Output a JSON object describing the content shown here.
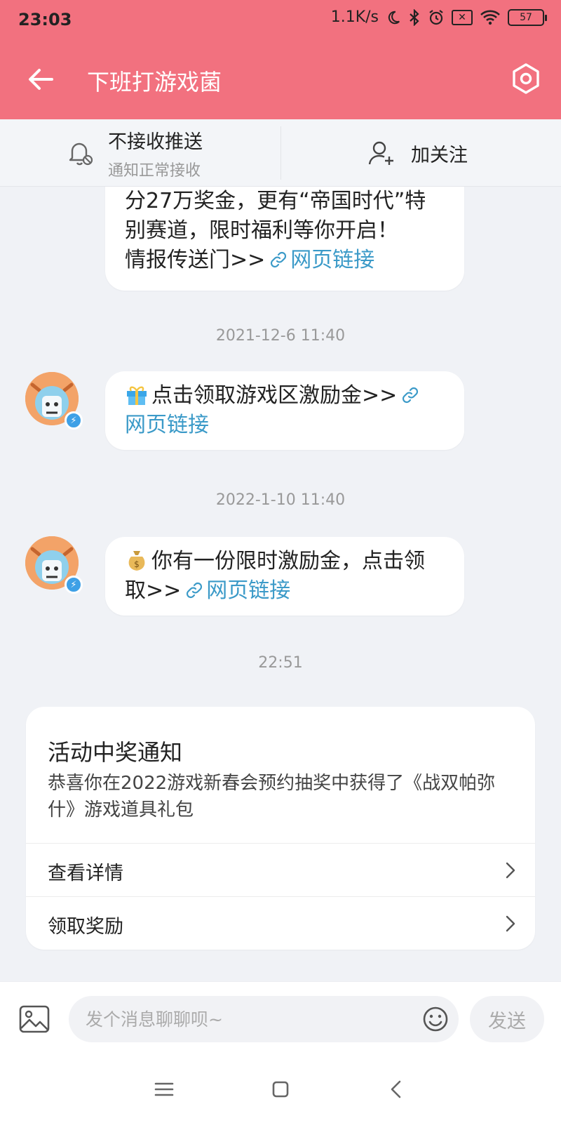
{
  "status_bar": {
    "time": "23:03",
    "net_speed": "1.1K/s",
    "battery": "57",
    "icons": [
      "moon-icon",
      "bluetooth-icon",
      "alarm-icon",
      "no-sim-icon",
      "wifi-icon",
      "battery-icon"
    ]
  },
  "header": {
    "title": "下班打游戏菌",
    "back_icon": "back-arrow-icon",
    "settings_icon": "hexagon-settings-icon",
    "bg_color": "#f2717f"
  },
  "notice_bar": {
    "push_label": "不接收推送",
    "push_sub": "通知正常接收",
    "follow_label": "加关注"
  },
  "messages": [
    {
      "lines": [
        "分27万奖金，更有“帝国时代”特",
        "别赛道，限时福利等你开启！",
        "情报传送门>>"
      ],
      "link": "网页链接"
    },
    {
      "timestamp": "2021-12-6 11:40",
      "text": "点击领取游戏区激励金>>",
      "emoji": "gift-icon",
      "link": "网页链接"
    },
    {
      "timestamp": "2022-1-10 11:40",
      "text_l1": "你有一份限时激励金，点击领",
      "text_l2": "取>>",
      "emoji": "money-bag-icon",
      "link": "网页链接"
    }
  ],
  "award": {
    "timestamp": "22:51",
    "title": "活动中奖通知",
    "desc": "恭喜你在2022游戏新春会预约抽奖中获得了《战双帕弥什》游戏道具礼包",
    "rows": [
      "查看详情",
      "领取奖励"
    ]
  },
  "input_bar": {
    "placeholder": "发个消息聊聊呗~",
    "send_label": "发送"
  },
  "colors": {
    "accent": "#f2717f",
    "link": "#3b9ac8",
    "background": "#f0f2f6"
  }
}
